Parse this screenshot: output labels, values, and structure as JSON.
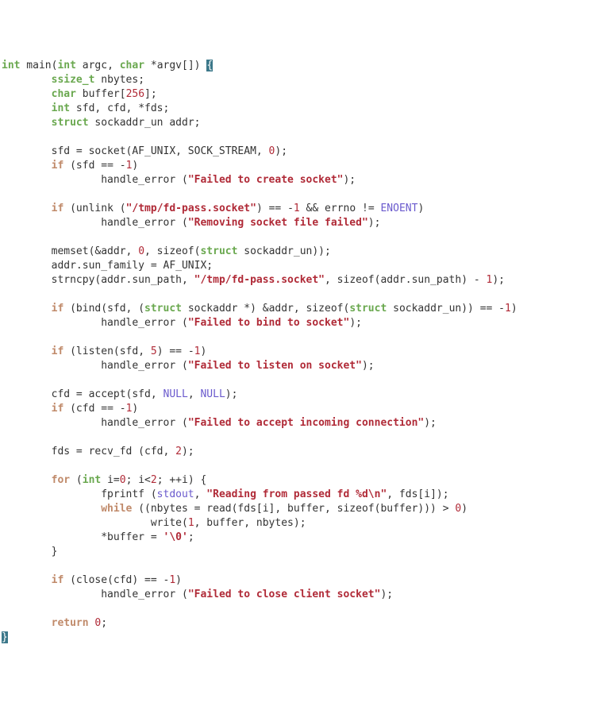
{
  "code": {
    "tokens": [
      [
        {
          "t": "int",
          "c": "kw"
        },
        {
          "t": " main(",
          "c": "pln"
        },
        {
          "t": "int",
          "c": "kw"
        },
        {
          "t": " argc, ",
          "c": "pln"
        },
        {
          "t": "char",
          "c": "kw"
        },
        {
          "t": " *argv[]) ",
          "c": "pln"
        },
        {
          "t": "{",
          "c": "cursor1"
        }
      ],
      [
        {
          "t": "        ",
          "c": "pln"
        },
        {
          "t": "ssize_t",
          "c": "kw"
        },
        {
          "t": " nbytes;",
          "c": "pln"
        }
      ],
      [
        {
          "t": "        ",
          "c": "pln"
        },
        {
          "t": "char",
          "c": "kw"
        },
        {
          "t": " buffer[",
          "c": "pln"
        },
        {
          "t": "256",
          "c": "num"
        },
        {
          "t": "];",
          "c": "pln"
        }
      ],
      [
        {
          "t": "        ",
          "c": "pln"
        },
        {
          "t": "int",
          "c": "kw"
        },
        {
          "t": " sfd, cfd, *fds;",
          "c": "pln"
        }
      ],
      [
        {
          "t": "        ",
          "c": "pln"
        },
        {
          "t": "struct",
          "c": "kw"
        },
        {
          "t": " sockaddr_un addr;",
          "c": "pln"
        }
      ],
      [
        {
          "t": "",
          "c": "pln"
        }
      ],
      [
        {
          "t": "        sfd = socket(AF_UNIX, SOCK_STREAM, ",
          "c": "pln"
        },
        {
          "t": "0",
          "c": "num"
        },
        {
          "t": ");",
          "c": "pln"
        }
      ],
      [
        {
          "t": "        ",
          "c": "pln"
        },
        {
          "t": "if",
          "c": "ctl"
        },
        {
          "t": " (sfd == -",
          "c": "pln"
        },
        {
          "t": "1",
          "c": "num"
        },
        {
          "t": ")",
          "c": "pln"
        }
      ],
      [
        {
          "t": "                handle_error (",
          "c": "pln"
        },
        {
          "t": "\"Failed to create socket\"",
          "c": "str"
        },
        {
          "t": ");",
          "c": "pln"
        }
      ],
      [
        {
          "t": "",
          "c": "pln"
        }
      ],
      [
        {
          "t": "        ",
          "c": "pln"
        },
        {
          "t": "if",
          "c": "ctl"
        },
        {
          "t": " (unlink (",
          "c": "pln"
        },
        {
          "t": "\"/tmp/fd-pass.socket\"",
          "c": "str"
        },
        {
          "t": ") == -",
          "c": "pln"
        },
        {
          "t": "1",
          "c": "num"
        },
        {
          "t": " && errno != ",
          "c": "pln"
        },
        {
          "t": "ENOENT",
          "c": "mac"
        },
        {
          "t": ")",
          "c": "pln"
        }
      ],
      [
        {
          "t": "                handle_error (",
          "c": "pln"
        },
        {
          "t": "\"Removing socket file failed\"",
          "c": "str"
        },
        {
          "t": ");",
          "c": "pln"
        }
      ],
      [
        {
          "t": "",
          "c": "pln"
        }
      ],
      [
        {
          "t": "        memset(&addr, ",
          "c": "pln"
        },
        {
          "t": "0",
          "c": "num"
        },
        {
          "t": ", sizeof(",
          "c": "pln"
        },
        {
          "t": "struct",
          "c": "kw"
        },
        {
          "t": " sockaddr_un));",
          "c": "pln"
        }
      ],
      [
        {
          "t": "        addr.sun_family = AF_UNIX;",
          "c": "pln"
        }
      ],
      [
        {
          "t": "        strncpy(addr.sun_path, ",
          "c": "pln"
        },
        {
          "t": "\"/tmp/fd-pass.socket\"",
          "c": "str"
        },
        {
          "t": ", sizeof(addr.sun_path) - ",
          "c": "pln"
        },
        {
          "t": "1",
          "c": "num"
        },
        {
          "t": ");",
          "c": "pln"
        }
      ],
      [
        {
          "t": "",
          "c": "pln"
        }
      ],
      [
        {
          "t": "        ",
          "c": "pln"
        },
        {
          "t": "if",
          "c": "ctl"
        },
        {
          "t": " (bind(sfd, (",
          "c": "pln"
        },
        {
          "t": "struct",
          "c": "kw"
        },
        {
          "t": " sockaddr *) &addr, sizeof(",
          "c": "pln"
        },
        {
          "t": "struct",
          "c": "kw"
        },
        {
          "t": " sockaddr_un)) == -",
          "c": "pln"
        },
        {
          "t": "1",
          "c": "num"
        },
        {
          "t": ")",
          "c": "pln"
        }
      ],
      [
        {
          "t": "                handle_error (",
          "c": "pln"
        },
        {
          "t": "\"Failed to bind to socket\"",
          "c": "str"
        },
        {
          "t": ");",
          "c": "pln"
        }
      ],
      [
        {
          "t": "",
          "c": "pln"
        }
      ],
      [
        {
          "t": "        ",
          "c": "pln"
        },
        {
          "t": "if",
          "c": "ctl"
        },
        {
          "t": " (listen(sfd, ",
          "c": "pln"
        },
        {
          "t": "5",
          "c": "num"
        },
        {
          "t": ") == -",
          "c": "pln"
        },
        {
          "t": "1",
          "c": "num"
        },
        {
          "t": ")",
          "c": "pln"
        }
      ],
      [
        {
          "t": "                handle_error (",
          "c": "pln"
        },
        {
          "t": "\"Failed to listen on socket\"",
          "c": "str"
        },
        {
          "t": ");",
          "c": "pln"
        }
      ],
      [
        {
          "t": "",
          "c": "pln"
        }
      ],
      [
        {
          "t": "        cfd = accept(sfd, ",
          "c": "pln"
        },
        {
          "t": "NULL",
          "c": "mac"
        },
        {
          "t": ", ",
          "c": "pln"
        },
        {
          "t": "NULL",
          "c": "mac"
        },
        {
          "t": ");",
          "c": "pln"
        }
      ],
      [
        {
          "t": "        ",
          "c": "pln"
        },
        {
          "t": "if",
          "c": "ctl"
        },
        {
          "t": " (cfd == -",
          "c": "pln"
        },
        {
          "t": "1",
          "c": "num"
        },
        {
          "t": ")",
          "c": "pln"
        }
      ],
      [
        {
          "t": "                handle_error (",
          "c": "pln"
        },
        {
          "t": "\"Failed to accept incoming connection\"",
          "c": "str"
        },
        {
          "t": ");",
          "c": "pln"
        }
      ],
      [
        {
          "t": "",
          "c": "pln"
        }
      ],
      [
        {
          "t": "        fds = recv_fd (cfd, ",
          "c": "pln"
        },
        {
          "t": "2",
          "c": "num"
        },
        {
          "t": ");",
          "c": "pln"
        }
      ],
      [
        {
          "t": "",
          "c": "pln"
        }
      ],
      [
        {
          "t": "        ",
          "c": "pln"
        },
        {
          "t": "for",
          "c": "ctl"
        },
        {
          "t": " (",
          "c": "pln"
        },
        {
          "t": "int",
          "c": "kw"
        },
        {
          "t": " i=",
          "c": "pln"
        },
        {
          "t": "0",
          "c": "num"
        },
        {
          "t": "; i<",
          "c": "pln"
        },
        {
          "t": "2",
          "c": "num"
        },
        {
          "t": "; ++i) {",
          "c": "pln"
        }
      ],
      [
        {
          "t": "                fprintf (",
          "c": "pln"
        },
        {
          "t": "stdout",
          "c": "mac"
        },
        {
          "t": ", ",
          "c": "pln"
        },
        {
          "t": "\"Reading from passed fd ",
          "c": "str"
        },
        {
          "t": "%d\\n",
          "c": "str"
        },
        {
          "t": "\"",
          "c": "str"
        },
        {
          "t": ", fds[i]);",
          "c": "pln"
        }
      ],
      [
        {
          "t": "                ",
          "c": "pln"
        },
        {
          "t": "while",
          "c": "ctl"
        },
        {
          "t": " ((nbytes = read(fds[i], buffer, sizeof(buffer))) > ",
          "c": "pln"
        },
        {
          "t": "0",
          "c": "num"
        },
        {
          "t": ")",
          "c": "pln"
        }
      ],
      [
        {
          "t": "                        write(",
          "c": "pln"
        },
        {
          "t": "1",
          "c": "num"
        },
        {
          "t": ", buffer, nbytes);",
          "c": "pln"
        }
      ],
      [
        {
          "t": "                *buffer = ",
          "c": "pln"
        },
        {
          "t": "'\\0'",
          "c": "str"
        },
        {
          "t": ";",
          "c": "pln"
        }
      ],
      [
        {
          "t": "        }",
          "c": "pln"
        }
      ],
      [
        {
          "t": "",
          "c": "pln"
        }
      ],
      [
        {
          "t": "        ",
          "c": "pln"
        },
        {
          "t": "if",
          "c": "ctl"
        },
        {
          "t": " (close(cfd) == -",
          "c": "pln"
        },
        {
          "t": "1",
          "c": "num"
        },
        {
          "t": ")",
          "c": "pln"
        }
      ],
      [
        {
          "t": "                handle_error (",
          "c": "pln"
        },
        {
          "t": "\"Failed to close client socket\"",
          "c": "str"
        },
        {
          "t": ");",
          "c": "pln"
        }
      ],
      [
        {
          "t": "",
          "c": "pln"
        }
      ],
      [
        {
          "t": "        ",
          "c": "pln"
        },
        {
          "t": "return",
          "c": "ctl"
        },
        {
          "t": " ",
          "c": "pln"
        },
        {
          "t": "0",
          "c": "num"
        },
        {
          "t": ";",
          "c": "pln"
        }
      ],
      [
        {
          "t": "}",
          "c": "cursor2"
        }
      ]
    ]
  }
}
